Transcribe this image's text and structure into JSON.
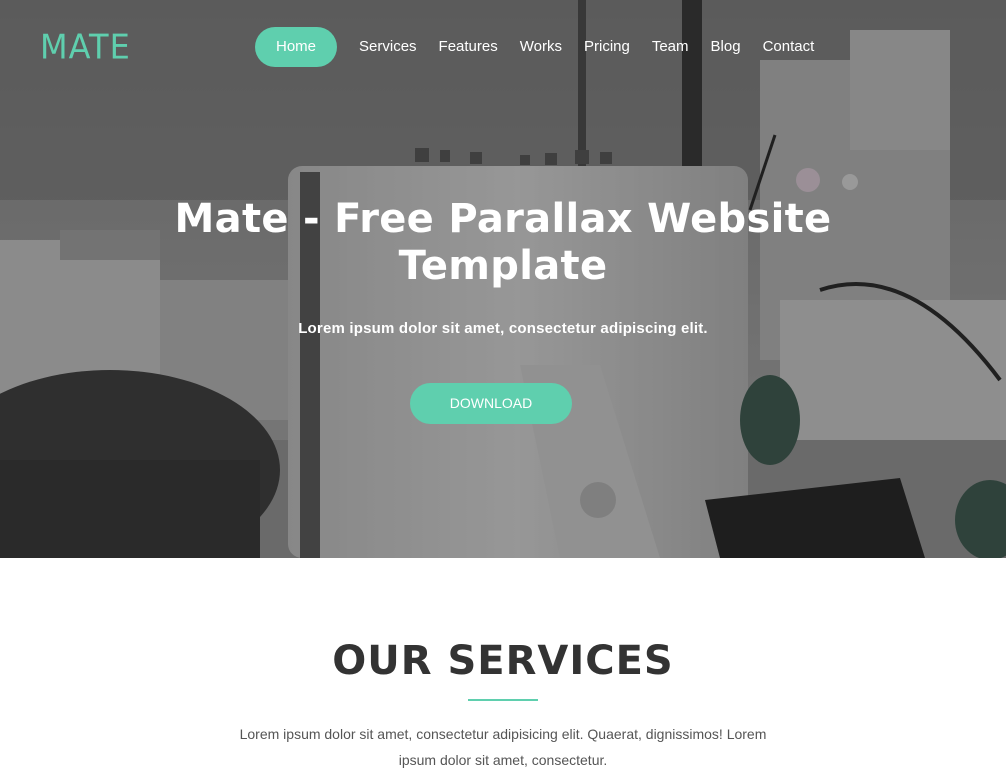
{
  "brand": {
    "logo": "MATE",
    "accent_color": "#5fcfae"
  },
  "nav": {
    "items": [
      {
        "label": "Home",
        "active": true
      },
      {
        "label": "Services",
        "active": false
      },
      {
        "label": "Features",
        "active": false
      },
      {
        "label": "Works",
        "active": false
      },
      {
        "label": "Pricing",
        "active": false
      },
      {
        "label": "Team",
        "active": false
      },
      {
        "label": "Blog",
        "active": false
      },
      {
        "label": "Contact",
        "active": false
      }
    ]
  },
  "hero": {
    "title": "Mate - Free Parallax Website Template",
    "subtitle": "Lorem ipsum dolor sit amet, consectetur adipiscing elit.",
    "cta_label": "DOWNLOAD"
  },
  "services": {
    "title": "OUR SERVICES",
    "description": "Lorem ipsum dolor sit amet, consectetur adipisicing elit. Quaerat, dignissimos! Lorem ipsum dolor sit amet, consectetur."
  }
}
